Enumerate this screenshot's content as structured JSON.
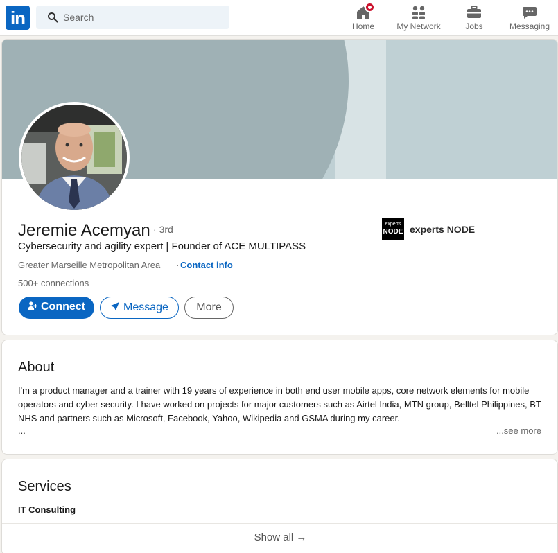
{
  "nav": {
    "logo": "in",
    "search_placeholder": "Search",
    "items": [
      {
        "label": "Home",
        "icon": "home-icon"
      },
      {
        "label": "My Network",
        "icon": "network-icon"
      },
      {
        "label": "Jobs",
        "icon": "briefcase-icon"
      },
      {
        "label": "Messaging",
        "icon": "message-icon"
      }
    ]
  },
  "profile": {
    "name": "Jeremie Acemyan",
    "degree": "3rd",
    "headline": "Cybersecurity and agility expert | Founder of ACE MULTIPASS",
    "location": "Greater Marseille Metropolitan Area",
    "dot": "·",
    "contact_label": "Contact info",
    "connections": "500+ connections",
    "company": {
      "name": "experts NODE",
      "logo_line1": "experts",
      "logo_line2": "NODE"
    },
    "buttons": {
      "connect": "Connect",
      "message": "Message",
      "more": "More"
    }
  },
  "about": {
    "title": "About",
    "text": "I'm a product manager and a trainer with 19 years of experience in both end user mobile apps, core network elements for mobile operators and cyber security. I have worked on projects for major customers such as Airtel India, MTN group, Belltel Philippines, BT NHS and partners such as Microsoft, Facebook, Yahoo, Wikipedia and GSMA during my career.",
    "ellipsis": "...",
    "see_more": "...see more"
  },
  "services": {
    "title": "Services",
    "item": "IT Consulting",
    "show_all": "Show all →"
  },
  "colors": {
    "accent": "#0a66c2",
    "notification": "#cb112d",
    "banner_light": "#bfd0d4",
    "banner_dark": "#9fb1b5"
  }
}
